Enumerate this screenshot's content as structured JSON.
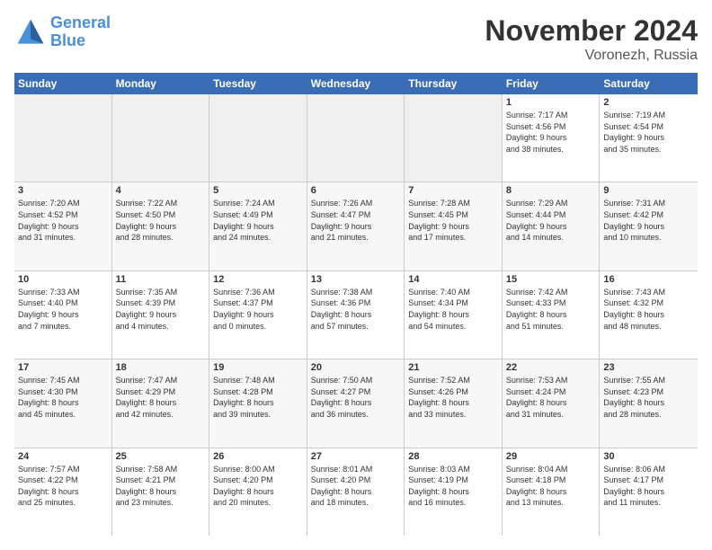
{
  "logo": {
    "line1": "General",
    "line2": "Blue"
  },
  "title": "November 2024",
  "location": "Voronezh, Russia",
  "days_of_week": [
    "Sunday",
    "Monday",
    "Tuesday",
    "Wednesday",
    "Thursday",
    "Friday",
    "Saturday"
  ],
  "weeks": [
    [
      {
        "day": "",
        "info": "",
        "empty": true
      },
      {
        "day": "",
        "info": "",
        "empty": true
      },
      {
        "day": "",
        "info": "",
        "empty": true
      },
      {
        "day": "",
        "info": "",
        "empty": true
      },
      {
        "day": "",
        "info": "",
        "empty": true
      },
      {
        "day": "1",
        "info": "Sunrise: 7:17 AM\nSunset: 4:56 PM\nDaylight: 9 hours\nand 38 minutes."
      },
      {
        "day": "2",
        "info": "Sunrise: 7:19 AM\nSunset: 4:54 PM\nDaylight: 9 hours\nand 35 minutes."
      }
    ],
    [
      {
        "day": "3",
        "info": "Sunrise: 7:20 AM\nSunset: 4:52 PM\nDaylight: 9 hours\nand 31 minutes."
      },
      {
        "day": "4",
        "info": "Sunrise: 7:22 AM\nSunset: 4:50 PM\nDaylight: 9 hours\nand 28 minutes."
      },
      {
        "day": "5",
        "info": "Sunrise: 7:24 AM\nSunset: 4:49 PM\nDaylight: 9 hours\nand 24 minutes."
      },
      {
        "day": "6",
        "info": "Sunrise: 7:26 AM\nSunset: 4:47 PM\nDaylight: 9 hours\nand 21 minutes."
      },
      {
        "day": "7",
        "info": "Sunrise: 7:28 AM\nSunset: 4:45 PM\nDaylight: 9 hours\nand 17 minutes."
      },
      {
        "day": "8",
        "info": "Sunrise: 7:29 AM\nSunset: 4:44 PM\nDaylight: 9 hours\nand 14 minutes."
      },
      {
        "day": "9",
        "info": "Sunrise: 7:31 AM\nSunset: 4:42 PM\nDaylight: 9 hours\nand 10 minutes."
      }
    ],
    [
      {
        "day": "10",
        "info": "Sunrise: 7:33 AM\nSunset: 4:40 PM\nDaylight: 9 hours\nand 7 minutes."
      },
      {
        "day": "11",
        "info": "Sunrise: 7:35 AM\nSunset: 4:39 PM\nDaylight: 9 hours\nand 4 minutes."
      },
      {
        "day": "12",
        "info": "Sunrise: 7:36 AM\nSunset: 4:37 PM\nDaylight: 9 hours\nand 0 minutes."
      },
      {
        "day": "13",
        "info": "Sunrise: 7:38 AM\nSunset: 4:36 PM\nDaylight: 8 hours\nand 57 minutes."
      },
      {
        "day": "14",
        "info": "Sunrise: 7:40 AM\nSunset: 4:34 PM\nDaylight: 8 hours\nand 54 minutes."
      },
      {
        "day": "15",
        "info": "Sunrise: 7:42 AM\nSunset: 4:33 PM\nDaylight: 8 hours\nand 51 minutes."
      },
      {
        "day": "16",
        "info": "Sunrise: 7:43 AM\nSunset: 4:32 PM\nDaylight: 8 hours\nand 48 minutes."
      }
    ],
    [
      {
        "day": "17",
        "info": "Sunrise: 7:45 AM\nSunset: 4:30 PM\nDaylight: 8 hours\nand 45 minutes."
      },
      {
        "day": "18",
        "info": "Sunrise: 7:47 AM\nSunset: 4:29 PM\nDaylight: 8 hours\nand 42 minutes."
      },
      {
        "day": "19",
        "info": "Sunrise: 7:48 AM\nSunset: 4:28 PM\nDaylight: 8 hours\nand 39 minutes."
      },
      {
        "day": "20",
        "info": "Sunrise: 7:50 AM\nSunset: 4:27 PM\nDaylight: 8 hours\nand 36 minutes."
      },
      {
        "day": "21",
        "info": "Sunrise: 7:52 AM\nSunset: 4:26 PM\nDaylight: 8 hours\nand 33 minutes."
      },
      {
        "day": "22",
        "info": "Sunrise: 7:53 AM\nSunset: 4:24 PM\nDaylight: 8 hours\nand 31 minutes."
      },
      {
        "day": "23",
        "info": "Sunrise: 7:55 AM\nSunset: 4:23 PM\nDaylight: 8 hours\nand 28 minutes."
      }
    ],
    [
      {
        "day": "24",
        "info": "Sunrise: 7:57 AM\nSunset: 4:22 PM\nDaylight: 8 hours\nand 25 minutes."
      },
      {
        "day": "25",
        "info": "Sunrise: 7:58 AM\nSunset: 4:21 PM\nDaylight: 8 hours\nand 23 minutes."
      },
      {
        "day": "26",
        "info": "Sunrise: 8:00 AM\nSunset: 4:20 PM\nDaylight: 8 hours\nand 20 minutes."
      },
      {
        "day": "27",
        "info": "Sunrise: 8:01 AM\nSunset: 4:20 PM\nDaylight: 8 hours\nand 18 minutes."
      },
      {
        "day": "28",
        "info": "Sunrise: 8:03 AM\nSunset: 4:19 PM\nDaylight: 8 hours\nand 16 minutes."
      },
      {
        "day": "29",
        "info": "Sunrise: 8:04 AM\nSunset: 4:18 PM\nDaylight: 8 hours\nand 13 minutes."
      },
      {
        "day": "30",
        "info": "Sunrise: 8:06 AM\nSunset: 4:17 PM\nDaylight: 8 hours\nand 11 minutes."
      }
    ]
  ]
}
